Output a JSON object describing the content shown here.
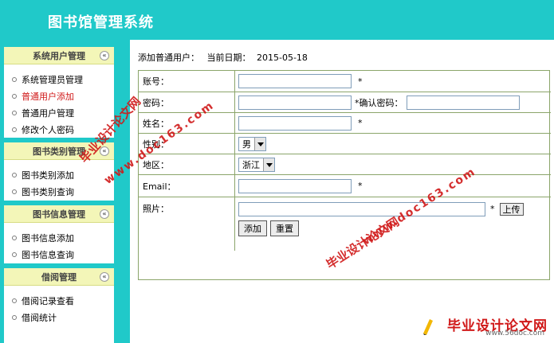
{
  "header": {
    "title": "图书馆管理系统"
  },
  "sidebar": {
    "panels": [
      {
        "title": "系统用户管理",
        "items": [
          "系统管理员管理",
          "普通用户添加",
          "普通用户管理",
          "修改个人密码"
        ]
      },
      {
        "title": "图书类别管理",
        "items": [
          "图书类别添加",
          "图书类别查询"
        ]
      },
      {
        "title": "图书信息管理",
        "items": [
          "图书信息添加",
          "图书信息查询"
        ]
      },
      {
        "title": "借阅管理",
        "items": [
          "借阅记录查看",
          "借阅统计"
        ]
      }
    ],
    "collapse_glyph": "«",
    "active_item": "普通用户添加"
  },
  "main": {
    "page_label": "添加普通用户：",
    "date_label": "当前日期：",
    "date_value": "2015-05-18",
    "form": {
      "account_label": "账号：",
      "password_label": "密码：",
      "confirm_label": "*确认密码：",
      "name_label": "姓名：",
      "gender_label": "性别：",
      "gender_value": "男",
      "region_label": "地区：",
      "region_value": "浙江",
      "email_label": "Email：",
      "photo_label": "照片：",
      "required_mark": "*",
      "upload_label": "上传",
      "add_button": "添加",
      "reset_button": "重置"
    }
  },
  "watermarks": {
    "left_cn": "毕业设计论文网",
    "left_url": "www.doc163.com",
    "right_url": "www.doc163.com",
    "right_cn": "毕业设计论文网"
  },
  "logo": {
    "name": "毕业设计论文网",
    "site": "www.56doc.com"
  },
  "colors": {
    "frame": "#20c9c9",
    "panel_head": "#f3f6b8",
    "watermark": "#d01818",
    "border": "#8ba56a"
  }
}
